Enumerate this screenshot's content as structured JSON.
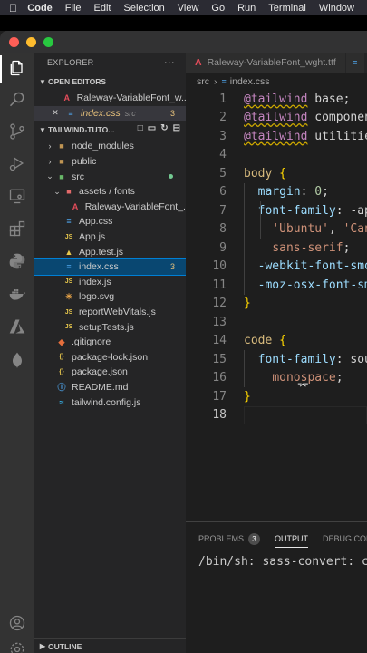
{
  "menubar": {
    "app": "Code",
    "items": [
      "File",
      "Edit",
      "Selection",
      "View",
      "Go",
      "Run",
      "Terminal",
      "Window"
    ]
  },
  "window": {
    "traffic_lights": [
      "#fe5f57",
      "#febc2e",
      "#28c840"
    ]
  },
  "sidebar": {
    "title": "EXPLORER",
    "open_editors": {
      "label": "OPEN EDITORS",
      "files": [
        {
          "name": "Raleway-VariableFont_w...",
          "icon": "font-icon",
          "detail": ""
        },
        {
          "name": "index.css",
          "icon": "css-icon",
          "detail": "src",
          "badge": "3"
        }
      ]
    },
    "project": {
      "label": "TAILWIND-TUTO...",
      "tree": [
        {
          "name": "node_modules",
          "kind": "folder",
          "depth": 1
        },
        {
          "name": "public",
          "kind": "folder",
          "depth": 1
        },
        {
          "name": "src",
          "kind": "folder-open",
          "depth": 1
        },
        {
          "name": "assets / fonts",
          "kind": "folder-open",
          "depth": 2
        },
        {
          "name": "Raleway-VariableFont_...",
          "kind": "font",
          "depth": 3
        },
        {
          "name": "App.css",
          "kind": "css",
          "depth": 2
        },
        {
          "name": "App.js",
          "kind": "js",
          "depth": 2
        },
        {
          "name": "App.test.js",
          "kind": "test",
          "depth": 2
        },
        {
          "name": "index.css",
          "kind": "css",
          "depth": 2,
          "badge": "3"
        },
        {
          "name": "index.js",
          "kind": "js",
          "depth": 2
        },
        {
          "name": "logo.svg",
          "kind": "svg",
          "depth": 2
        },
        {
          "name": "reportWebVitals.js",
          "kind": "js",
          "depth": 2
        },
        {
          "name": "setupTests.js",
          "kind": "js",
          "depth": 2
        },
        {
          "name": ".gitignore",
          "kind": "git",
          "depth": 1
        },
        {
          "name": "package-lock.json",
          "kind": "json",
          "depth": 1
        },
        {
          "name": "package.json",
          "kind": "json",
          "depth": 1
        },
        {
          "name": "README.md",
          "kind": "info",
          "depth": 1
        },
        {
          "name": "tailwind.config.js",
          "kind": "tailwind",
          "depth": 1
        }
      ]
    },
    "outline_label": "OUTLINE"
  },
  "tabs": [
    {
      "label": "Raleway-VariableFont_wght.ttf"
    }
  ],
  "breadcrumb": {
    "folder": "src",
    "file": "index.css"
  },
  "editor": {
    "lines": [
      {
        "n": "1",
        "tokens": [
          [
            "tw",
            "@tailwind"
          ],
          [
            "plain",
            " base;"
          ]
        ]
      },
      {
        "n": "2",
        "tokens": [
          [
            "tw",
            "@tailwind"
          ],
          [
            "plain",
            " components;"
          ]
        ]
      },
      {
        "n": "3",
        "tokens": [
          [
            "tw",
            "@tailwind"
          ],
          [
            "plain",
            " utilities;"
          ]
        ]
      },
      {
        "n": "4",
        "tokens": []
      },
      {
        "n": "5",
        "tokens": [
          [
            "sel",
            "body"
          ],
          [
            "plain",
            " "
          ],
          [
            "brace",
            "{"
          ]
        ]
      },
      {
        "n": "6",
        "tokens": [
          [
            "plain",
            "  "
          ],
          [
            "prop",
            "margin"
          ],
          [
            "plain",
            ": "
          ],
          [
            "num",
            "0"
          ],
          [
            "plain",
            ";"
          ]
        ]
      },
      {
        "n": "7",
        "tokens": [
          [
            "plain",
            "  "
          ],
          [
            "prop",
            "font-family"
          ],
          [
            "plain",
            ": -apple-system"
          ]
        ]
      },
      {
        "n": "8",
        "tokens": [
          [
            "plain",
            "    "
          ],
          [
            "str",
            "'Ubuntu'"
          ],
          [
            "plain",
            ", "
          ],
          [
            "str",
            "'Cantarell'"
          ]
        ]
      },
      {
        "n": "9",
        "tokens": [
          [
            "plain",
            "    "
          ],
          [
            "str",
            "sans-serif"
          ],
          [
            "plain",
            ";"
          ]
        ]
      },
      {
        "n": "10",
        "tokens": [
          [
            "plain",
            "  "
          ],
          [
            "prop",
            "-webkit-font-smoothing"
          ]
        ]
      },
      {
        "n": "11",
        "tokens": [
          [
            "plain",
            "  "
          ],
          [
            "prop",
            "-moz-osx-font-smoothing"
          ]
        ]
      },
      {
        "n": "12",
        "tokens": [
          [
            "brace",
            "}"
          ]
        ]
      },
      {
        "n": "13",
        "tokens": []
      },
      {
        "n": "14",
        "tokens": [
          [
            "sel",
            "code"
          ],
          [
            "plain",
            " "
          ],
          [
            "brace",
            "{"
          ]
        ]
      },
      {
        "n": "15",
        "tokens": [
          [
            "plain",
            "  "
          ],
          [
            "prop",
            "font-family"
          ],
          [
            "plain",
            ": source-code-pro"
          ]
        ]
      },
      {
        "n": "16",
        "tokens": [
          [
            "plain",
            "    "
          ],
          [
            "str",
            "monospace"
          ],
          [
            "plain",
            ";"
          ]
        ]
      },
      {
        "n": "17",
        "tokens": [
          [
            "brace",
            "}"
          ]
        ]
      },
      {
        "n": "18",
        "tokens": []
      }
    ],
    "current_line": "18"
  },
  "panel": {
    "tabs": [
      {
        "label": "PROBLEMS",
        "badge": "3"
      },
      {
        "label": "OUTPUT"
      },
      {
        "label": "DEBUG CONSOLE"
      }
    ],
    "active_tab": "OUTPUT",
    "output": "/bin/sh: sass-convert: command not found"
  }
}
